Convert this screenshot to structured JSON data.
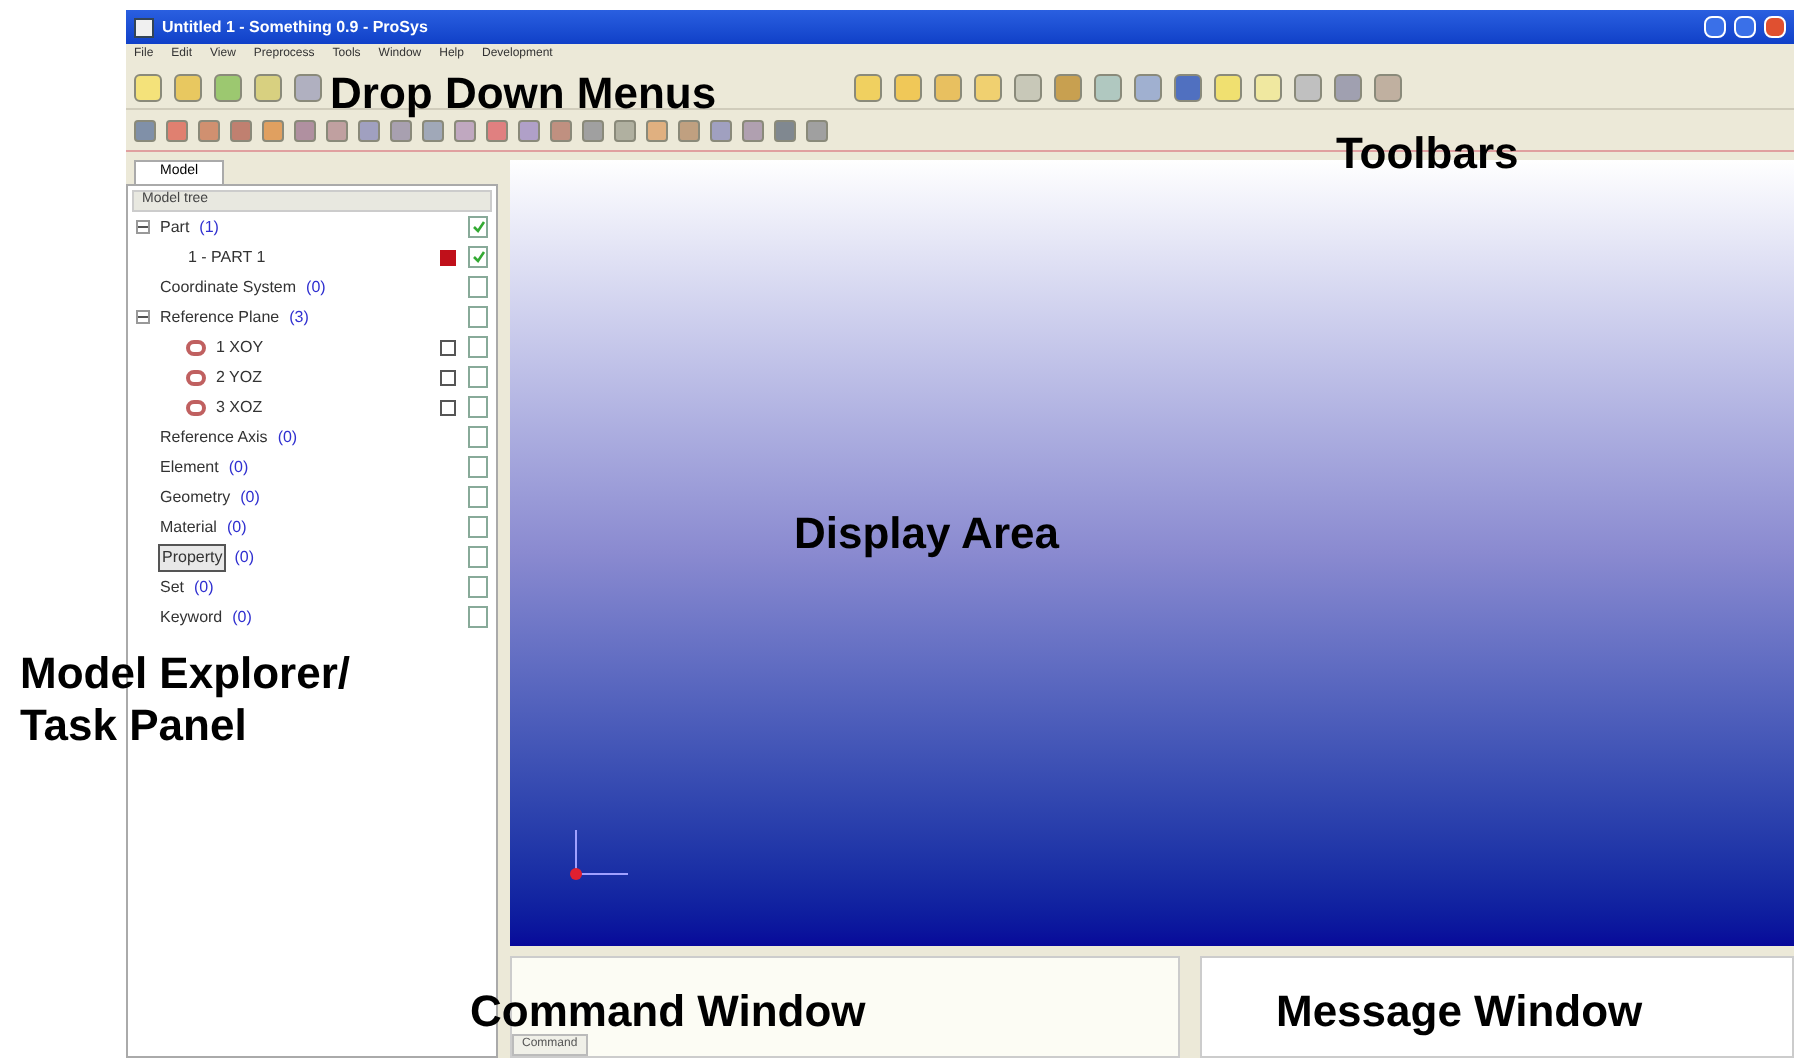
{
  "window": {
    "title": "Untitled 1 - Something 0.9 - ProSys"
  },
  "menu": [
    "File",
    "Edit",
    "View",
    "Preprocess",
    "Tools",
    "Window",
    "Help",
    "Development"
  ],
  "panel": {
    "tabs": [
      {
        "label": "Model",
        "selected": true
      }
    ],
    "header": "Model tree",
    "tree": [
      {
        "label": "Part",
        "count": "(1)",
        "checked": true,
        "expanded": true,
        "children": [
          {
            "label": "1 - PART 1",
            "checked": true,
            "color": "#c0101a"
          }
        ]
      },
      {
        "label": "Coordinate System",
        "count": "(0)",
        "checked": false
      },
      {
        "label": "Reference Plane",
        "count": "(3)",
        "checked": false,
        "expanded": true,
        "children": [
          {
            "label": "1  XOY",
            "checked": false,
            "shown": false,
            "kind": "plane"
          },
          {
            "label": "2  YOZ",
            "checked": false,
            "shown": false,
            "kind": "plane"
          },
          {
            "label": "3  XOZ",
            "checked": false,
            "shown": false,
            "kind": "plane"
          }
        ]
      },
      {
        "label": "Reference Axis",
        "count": "(0)",
        "checked": false
      },
      {
        "label": "Element",
        "count": "(0)",
        "checked": false
      },
      {
        "label": "Geometry",
        "count": "(0)",
        "checked": false
      },
      {
        "label": "Material",
        "count": "(0)",
        "checked": false
      },
      {
        "label": "Property",
        "count": "(0)",
        "checked": false,
        "selected": true
      },
      {
        "label": "Set",
        "count": "(0)",
        "checked": false
      },
      {
        "label": "Keyword",
        "count": "(0)",
        "checked": false
      }
    ]
  },
  "command": {
    "tab": "Command"
  },
  "annotations": [
    {
      "kind": "menus",
      "text": "Drop Down Menus"
    },
    {
      "kind": "toolbars",
      "text": "Toolbars"
    },
    {
      "kind": "display",
      "text": "Display Area"
    },
    {
      "kind": "explorer",
      "text": "Model Explorer/\nTask Panel"
    },
    {
      "kind": "command",
      "text": "Command Window"
    },
    {
      "kind": "message",
      "text": "Message Window"
    }
  ]
}
